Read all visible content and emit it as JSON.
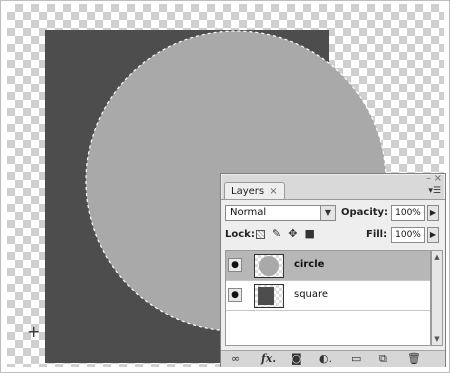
{
  "panel": {
    "tab_label": "Layers",
    "tab_close": "×",
    "minimize": "–",
    "close": "×",
    "menu_icon": "panel-menu-icon",
    "blend_mode": "Normal",
    "opacity_label": "Opacity:",
    "opacity_value": "100%",
    "lock_label": "Lock:",
    "fill_label": "Fill:",
    "fill_value": "100%"
  },
  "layers": [
    {
      "name": "circle",
      "visible": true,
      "selected": true,
      "thumbnail": "circle-thumbnail"
    },
    {
      "name": "square",
      "visible": true,
      "selected": false,
      "thumbnail": "square-thumbnail"
    }
  ],
  "bottom_icons": [
    "link-layers-icon",
    "fx-icon",
    "layer-mask-icon",
    "adjustment-layer-icon",
    "new-group-icon",
    "new-layer-icon",
    "trash-icon"
  ],
  "canvas": {
    "square_color": "#4d4d4d",
    "circle_color": "#a9a9a9",
    "selection": "marching-ants"
  }
}
